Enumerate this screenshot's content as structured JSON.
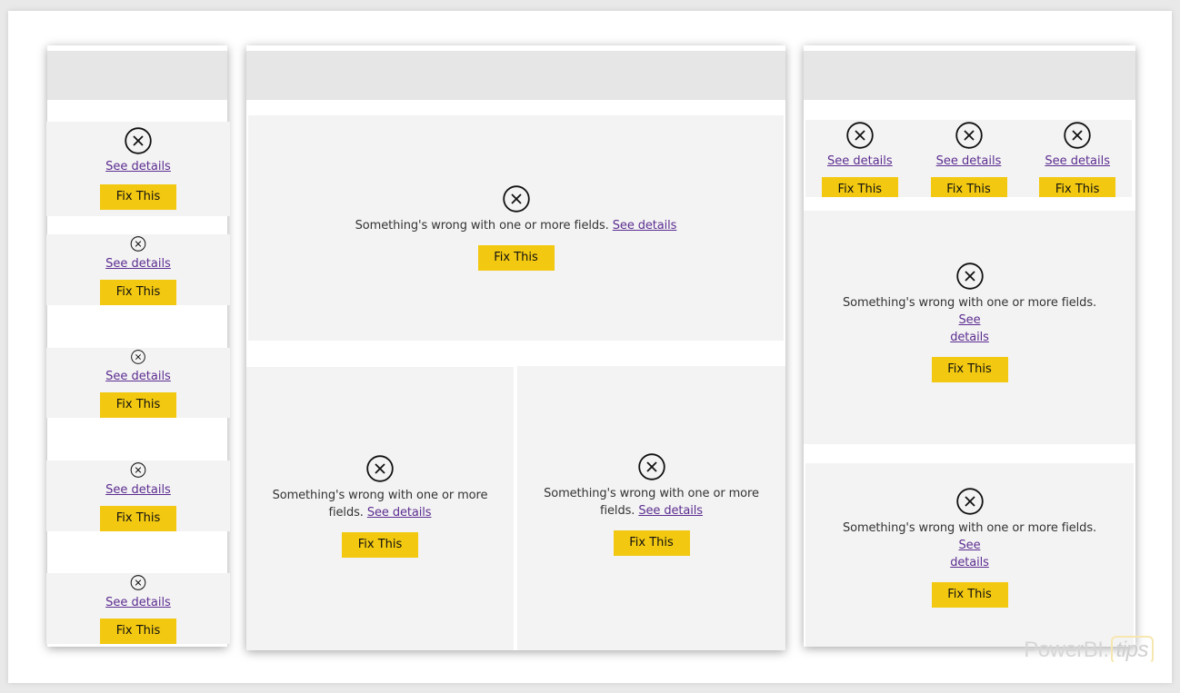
{
  "error_message": "Something's wrong with one or more fields.",
  "see_details_label": "See details",
  "fix_button_label": "Fix This",
  "colors": {
    "fix_button": "#f2c811",
    "link": "#5c2d91",
    "tile_bg": "#f3f3f3",
    "header_bg": "#e6e6e6"
  },
  "left_panel": {
    "tiles": [
      {
        "link": "See details",
        "button": "Fix This"
      },
      {
        "link": "See details",
        "button": "Fix This"
      },
      {
        "link": "See details",
        "button": "Fix This"
      },
      {
        "link": "See details",
        "button": "Fix This"
      },
      {
        "link": "See details",
        "button": "Fix This"
      }
    ]
  },
  "center_panel": {
    "top_tile": {
      "message": "Something's wrong with one or more fields.",
      "link": "See details",
      "button": "Fix This"
    },
    "bottom_left_tile": {
      "message": "Something's wrong with one or more fields.",
      "link": "See details",
      "button": "Fix This"
    },
    "bottom_right_tile": {
      "message": "Something's wrong with one or more fields.",
      "link": "See details",
      "button": "Fix This"
    }
  },
  "right_panel": {
    "small_tiles": [
      {
        "link": "See details",
        "button": "Fix This"
      },
      {
        "link": "See details",
        "button": "Fix This"
      },
      {
        "link": "See details",
        "button": "Fix This"
      }
    ],
    "middle_tile": {
      "message": "Something's wrong with one or more fields.",
      "link_part1": "See",
      "link_part2": "details",
      "button": "Fix This"
    },
    "bottom_tile": {
      "message": "Something's wrong with one or more fields.",
      "link_part1": "See",
      "link_part2": "details",
      "button": "Fix This"
    }
  },
  "watermark": {
    "brand": "PowerBI.",
    "suffix": "tips"
  }
}
